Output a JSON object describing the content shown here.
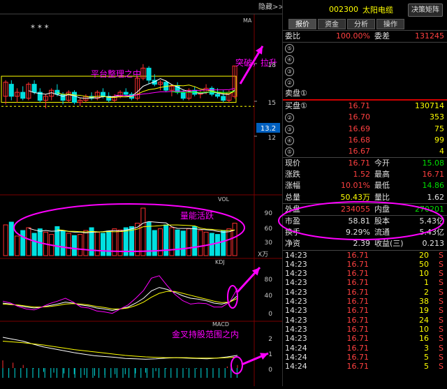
{
  "header": {
    "code": "002300",
    "name": "太阳电缆",
    "hide_button": "隐藏>>",
    "decision_button": "决策矩阵"
  },
  "tabs": [
    {
      "label": "报价"
    },
    {
      "label": "资金"
    },
    {
      "label": "分析"
    },
    {
      "label": "操作"
    }
  ],
  "weibi": {
    "label": "委比",
    "value": "100.00%",
    "label2": "委差",
    "value2": "131245"
  },
  "sell": [
    {
      "label": "⑤",
      "price": "",
      "vol": ""
    },
    {
      "label": "④",
      "price": "",
      "vol": ""
    },
    {
      "label": "③",
      "price": "",
      "vol": ""
    },
    {
      "label": "②",
      "price": "",
      "vol": ""
    },
    {
      "label": "卖盘①",
      "price": "",
      "vol": ""
    }
  ],
  "buy": [
    {
      "label": "买盘①",
      "price": "16.71",
      "vol": "130714"
    },
    {
      "label": "②",
      "price": "16.70",
      "vol": "353"
    },
    {
      "label": "③",
      "price": "16.69",
      "vol": "75"
    },
    {
      "label": "④",
      "price": "16.68",
      "vol": "99"
    },
    {
      "label": "⑤",
      "price": "16.67",
      "vol": "4"
    }
  ],
  "quote": [
    {
      "l1": "现价",
      "v1": "16.71",
      "l2": "今开",
      "v2": "15.08"
    },
    {
      "l1": "涨跌",
      "v1": "1.52",
      "l2": "最高",
      "v2": "16.71"
    },
    {
      "l1": "涨幅",
      "v1": "10.01%",
      "l2": "最低",
      "v2": "14.86"
    },
    {
      "l1": "总量",
      "v1": "50.43万",
      "l2": "量比",
      "v2": "1.62"
    },
    {
      "l1": "外盘",
      "v1": "234055",
      "l2": "内盘",
      "v2": "270201"
    },
    {
      "l1": "市盈",
      "v1": "58.81",
      "l2": "股本",
      "v2": "5.43亿"
    },
    {
      "l1": "换手",
      "v1": "9.29%",
      "l2": "流通",
      "v2": "5.43亿"
    },
    {
      "l1": "净资",
      "v1": "2.39",
      "l2": "收益(三)",
      "v2": "0.213"
    }
  ],
  "ticks": [
    {
      "time": "14:23",
      "price": "16.71",
      "vol": "20",
      "flag": "S"
    },
    {
      "time": "14:23",
      "price": "16.71",
      "vol": "50",
      "flag": "S"
    },
    {
      "time": "14:23",
      "price": "16.71",
      "vol": "10",
      "flag": "S"
    },
    {
      "time": "14:23",
      "price": "16.71",
      "vol": "1",
      "flag": "S"
    },
    {
      "time": "14:23",
      "price": "16.71",
      "vol": "2",
      "flag": "S"
    },
    {
      "time": "14:23",
      "price": "16.71",
      "vol": "38",
      "flag": "S"
    },
    {
      "time": "14:23",
      "price": "16.71",
      "vol": "19",
      "flag": "S"
    },
    {
      "time": "14:23",
      "price": "16.71",
      "vol": "24",
      "flag": "S"
    },
    {
      "time": "14:23",
      "price": "16.71",
      "vol": "10",
      "flag": "S"
    },
    {
      "time": "14:23",
      "price": "16.71",
      "vol": "16",
      "flag": "S"
    },
    {
      "time": "14:24",
      "price": "16.71",
      "vol": "3",
      "flag": "S"
    },
    {
      "time": "14:24",
      "price": "16.71",
      "vol": "5",
      "flag": "S"
    },
    {
      "time": "14:24",
      "price": "16.71",
      "vol": "5",
      "flag": "S"
    }
  ],
  "chart_labels": {
    "ma": "MA",
    "vol": "VOL",
    "kdj": "KDJ",
    "macd": "MACD",
    "stars": "*   * *",
    "vol_unit": "X万",
    "price_ticks": [
      "18",
      "15",
      "12"
    ],
    "current_price": "13.2",
    "vol_ticks": [
      "90",
      "60",
      "30"
    ],
    "kdj_ticks": [
      "80",
      "40",
      "0"
    ],
    "macd_ticks": [
      "2",
      "1",
      "0"
    ]
  },
  "annotations": {
    "platform": "平台整理之中",
    "breakout": "突破，拉升",
    "volume": "量能活跃",
    "golden_cross": "金叉持股范围之内"
  },
  "colors": {
    "up": "#ff3030",
    "down": "#00e0e0",
    "annotation": "#ff00ff",
    "ma": "#ffffff",
    "box": "#ffff00"
  },
  "chart_data": {
    "type": "candlestick",
    "candles": [
      {
        "o": 15.2,
        "h": 16.0,
        "l": 14.8,
        "c": 15.9
      },
      {
        "o": 15.8,
        "h": 16.0,
        "l": 15.0,
        "c": 15.2
      },
      {
        "o": 15.2,
        "h": 15.6,
        "l": 14.9,
        "c": 15.4
      },
      {
        "o": 15.4,
        "h": 15.7,
        "l": 15.0,
        "c": 15.1
      },
      {
        "o": 15.1,
        "h": 15.9,
        "l": 15.0,
        "c": 15.8
      },
      {
        "o": 15.8,
        "h": 16.0,
        "l": 15.3,
        "c": 15.4
      },
      {
        "o": 15.4,
        "h": 15.6,
        "l": 14.9,
        "c": 15.0
      },
      {
        "o": 15.0,
        "h": 15.3,
        "l": 14.6,
        "c": 15.2
      },
      {
        "o": 15.2,
        "h": 15.6,
        "l": 15.0,
        "c": 15.5
      },
      {
        "o": 15.5,
        "h": 15.8,
        "l": 15.2,
        "c": 15.3
      },
      {
        "o": 15.3,
        "h": 15.4,
        "l": 14.8,
        "c": 15.0
      },
      {
        "o": 15.0,
        "h": 15.5,
        "l": 14.9,
        "c": 15.4
      },
      {
        "o": 15.4,
        "h": 15.5,
        "l": 14.8,
        "c": 14.9
      },
      {
        "o": 14.9,
        "h": 15.1,
        "l": 14.7,
        "c": 15.0
      },
      {
        "o": 15.0,
        "h": 15.3,
        "l": 14.9,
        "c": 15.2
      },
      {
        "o": 15.2,
        "h": 15.4,
        "l": 15.0,
        "c": 15.1
      },
      {
        "o": 15.1,
        "h": 15.5,
        "l": 15.0,
        "c": 15.4
      },
      {
        "o": 15.4,
        "h": 15.6,
        "l": 15.1,
        "c": 15.2
      },
      {
        "o": 15.2,
        "h": 15.4,
        "l": 14.9,
        "c": 15.0
      },
      {
        "o": 15.0,
        "h": 15.3,
        "l": 14.9,
        "c": 15.2
      },
      {
        "o": 15.2,
        "h": 15.5,
        "l": 15.1,
        "c": 15.4
      },
      {
        "o": 15.4,
        "h": 15.6,
        "l": 15.2,
        "c": 15.3
      },
      {
        "o": 15.3,
        "h": 15.4,
        "l": 15.0,
        "c": 15.1
      },
      {
        "o": 15.1,
        "h": 16.2,
        "l": 15.0,
        "c": 16.1
      },
      {
        "o": 16.1,
        "h": 16.8,
        "l": 16.0,
        "c": 16.6
      },
      {
        "o": 16.6,
        "h": 16.7,
        "l": 15.8,
        "c": 16.0
      },
      {
        "o": 16.0,
        "h": 16.3,
        "l": 15.7,
        "c": 15.8
      },
      {
        "o": 15.8,
        "h": 16.0,
        "l": 15.5,
        "c": 15.9
      },
      {
        "o": 15.9,
        "h": 16.0,
        "l": 15.4,
        "c": 15.5
      },
      {
        "o": 15.5,
        "h": 15.8,
        "l": 15.2,
        "c": 15.7
      },
      {
        "o": 15.7,
        "h": 15.9,
        "l": 15.3,
        "c": 15.4
      },
      {
        "o": 15.4,
        "h": 15.5,
        "l": 15.0,
        "c": 15.1
      },
      {
        "o": 15.1,
        "h": 15.6,
        "l": 15.0,
        "c": 15.5
      },
      {
        "o": 15.5,
        "h": 15.7,
        "l": 15.2,
        "c": 15.3
      },
      {
        "o": 15.3,
        "h": 15.5,
        "l": 15.1,
        "c": 15.4
      },
      {
        "o": 15.4,
        "h": 15.8,
        "l": 15.3,
        "c": 15.6
      },
      {
        "o": 15.6,
        "h": 15.7,
        "l": 15.2,
        "c": 15.3
      },
      {
        "o": 15.3,
        "h": 15.6,
        "l": 15.1,
        "c": 15.2
      },
      {
        "o": 15.2,
        "h": 15.5,
        "l": 14.9,
        "c": 15.0
      },
      {
        "o": 15.0,
        "h": 15.5,
        "l": 14.9,
        "c": 15.4
      },
      {
        "o": 15.19,
        "h": 16.71,
        "l": 15.08,
        "c": 16.71
      }
    ],
    "volume": [
      55,
      60,
      35,
      45,
      50,
      40,
      48,
      42,
      38,
      52,
      44,
      40,
      36,
      38,
      45,
      50,
      42,
      40,
      44,
      48,
      46,
      50,
      52,
      58,
      85,
      60,
      45,
      48,
      55,
      50,
      46,
      44,
      48,
      52,
      45,
      42,
      40,
      38,
      45,
      48,
      58
    ],
    "kdj": {
      "k": [
        30,
        28,
        25,
        22,
        20,
        22,
        25,
        28,
        32,
        30,
        26,
        24,
        20,
        18,
        15,
        18,
        22,
        30,
        40,
        55,
        62,
        58,
        52,
        45,
        40,
        38,
        35,
        30,
        28,
        32,
        45
      ],
      "d": [
        28,
        27,
        26,
        24,
        22,
        22,
        23,
        25,
        28,
        29,
        28,
        26,
        23,
        21,
        18,
        18,
        20,
        25,
        32,
        42,
        50,
        54,
        54,
        50,
        46,
        42,
        38,
        34,
        31,
        32,
        40
      ],
      "j": [
        34,
        30,
        23,
        18,
        16,
        22,
        29,
        34,
        40,
        32,
        22,
        20,
        14,
        12,
        9,
        18,
        26,
        40,
        56,
        81,
        86,
        66,
        48,
        35,
        28,
        30,
        29,
        22,
        22,
        32,
        60
      ]
    },
    "macd": {
      "dif": [
        0.8,
        0.75,
        0.7,
        0.62,
        0.55,
        0.5,
        0.45,
        0.4,
        0.36,
        0.32,
        0.3,
        0.28,
        0.25,
        0.24,
        0.23,
        0.24,
        0.26,
        0.27,
        0.26,
        0.25,
        0.24,
        0.26,
        0.29,
        0.33
      ],
      "dea": [
        0.7,
        0.68,
        0.66,
        0.63,
        0.6,
        0.56,
        0.52,
        0.48,
        0.45,
        0.42,
        0.39,
        0.36,
        0.33,
        0.31,
        0.29,
        0.28,
        0.27,
        0.27,
        0.27,
        0.26,
        0.26,
        0.26,
        0.27,
        0.29
      ]
    }
  }
}
